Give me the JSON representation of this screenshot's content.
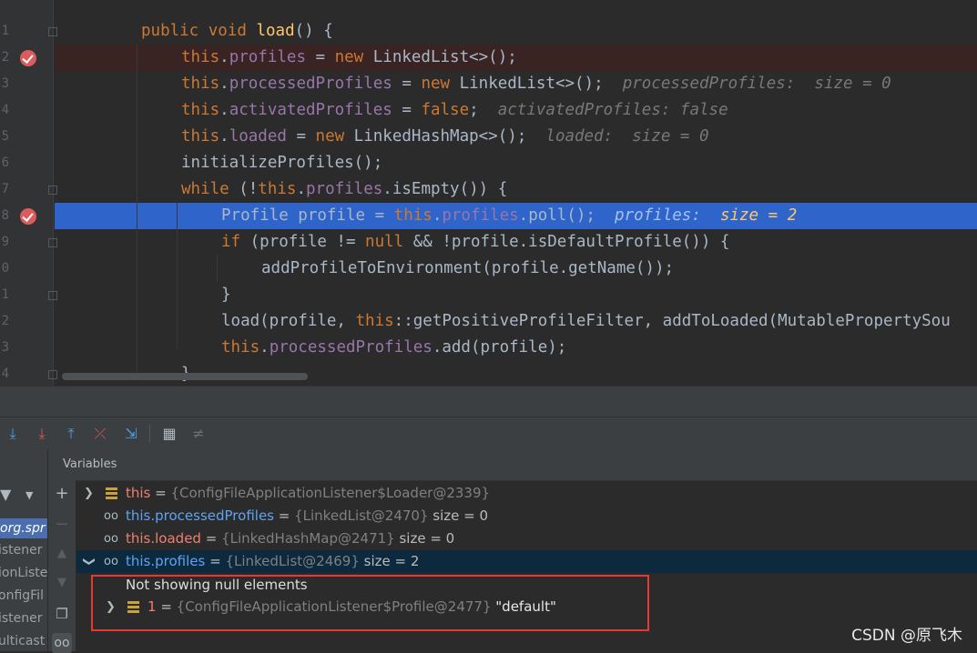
{
  "editor": {
    "line_numbers": [
      "1",
      "2",
      "3",
      "4",
      "5",
      "6",
      "7",
      "8",
      "9",
      "0",
      "1",
      "2",
      "3",
      "4"
    ],
    "lines": {
      "l1": {
        "kw1": "public",
        "kw2": "void",
        "fn": "load",
        "rest": "() {"
      },
      "l2": {
        "this": "this",
        "dot": ".",
        "field": "profiles",
        "eq": " = ",
        "new": "new",
        "rest": " LinkedList<>();"
      },
      "l3": {
        "this": "this",
        "dot": ".",
        "field": "processedProfiles",
        "eq": " = ",
        "new": "new",
        "rest": " LinkedList<>();",
        "hint": "processedProfiles:  size = 0"
      },
      "l4": {
        "this": "this",
        "dot": ".",
        "field": "activatedProfiles",
        "eq": " = ",
        "kw": "false",
        "semi": ";",
        "hint": "activatedProfiles: false"
      },
      "l5": {
        "this": "this",
        "dot": ".",
        "field": "loaded",
        "eq": " = ",
        "new": "new",
        "rest": " LinkedHashMap<>();",
        "hint": "loaded:  size = 0"
      },
      "l6": {
        "text": "initializeProfiles();"
      },
      "l7": {
        "while": "while",
        "pre": " (!",
        "this": "this",
        "dot": ".",
        "field": "profiles",
        "rest": ".isEmpty()) {"
      },
      "l8": {
        "pre": "Profile profile = ",
        "this": "this",
        "dot": ".",
        "field": "profiles",
        "rest": ".poll();",
        "hint": "profiles:",
        "hintv": "size = 2"
      },
      "l9": {
        "if": "if",
        "pre": " (profile != ",
        "null": "null",
        "rest": " && !profile.isDefaultProfile()) {"
      },
      "l10": {
        "text": "addProfileToEnvironment(profile.getName());"
      },
      "l11": {
        "text": "}"
      },
      "l12": {
        "pre": "load(profile, ",
        "this": "this",
        "rest": "::getPositiveProfileFilter, addToLoaded(MutablePropertySou"
      },
      "l13": {
        "this": "this",
        "dot": ".",
        "field": "processedProfiles",
        "rest": ".add(profile);"
      },
      "l14": {
        "text": "}"
      }
    }
  },
  "toolbar": {
    "icons": [
      "step-over-icon",
      "step-into-icon",
      "force-step-into-icon",
      "step-out-icon",
      "drop-frame-icon",
      "run-to-cursor-icon",
      "evaluate-expression-icon",
      "trace-stream-icon"
    ]
  },
  "frames": {
    "items": [
      "org.spr",
      "istener",
      "ionListe",
      "onfigFil",
      "istener",
      "ulticast"
    ]
  },
  "variables": {
    "title": "Variables",
    "rows": [
      {
        "name": "this",
        "eq": " = ",
        "ref": "{ConfigFileApplicationListener$Loader@2339}",
        "extra": ""
      },
      {
        "name": "this.processedProfiles",
        "eq": " = ",
        "ref": "{LinkedList@2470}",
        "extra": "  size = 0"
      },
      {
        "name": "this.loaded",
        "eq": " = ",
        "ref": "{LinkedHashMap@2471}",
        "extra": "  size = 0"
      },
      {
        "name": "this.profiles",
        "eq": " = ",
        "ref": "{LinkedList@2469}",
        "extra": "  size = 2"
      }
    ],
    "null_note": "Not showing null elements",
    "child": {
      "name": "1",
      "eq": " = ",
      "ref": "{ConfigFileApplicationListener$Profile@2477}",
      "extra": " \"default\""
    }
  },
  "watermark": "CSDN @原飞木",
  "colors": {
    "accent_selection": "#2f65ca",
    "breakpoint": "#db5c5c",
    "highlight_box": "#e53935"
  }
}
